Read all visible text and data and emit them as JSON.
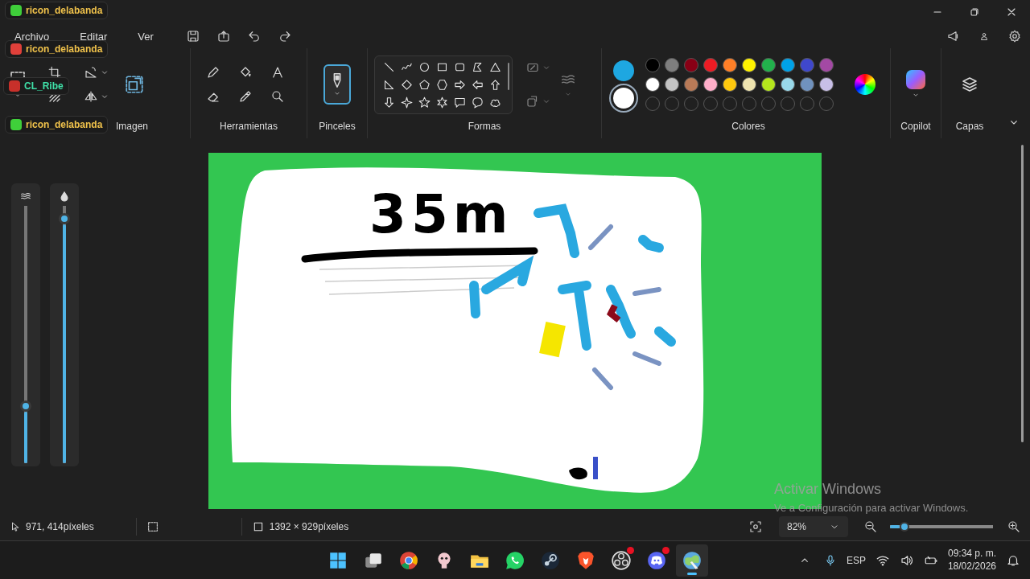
{
  "chat_overlay": [
    {
      "user": "ricon_delabanda",
      "color": "#f0c24b",
      "emote": {
        "color": "#3fcf3a"
      }
    },
    {
      "user": "ricon_delabanda",
      "color": "#f0c24b",
      "emote": {
        "color": "#e0403a"
      }
    },
    {
      "user": "CL_Ribe",
      "color": "#3fe0a8",
      "emote": {
        "color": "#c8302a"
      }
    },
    {
      "user": "ricon_delabanda",
      "color": "#f0c24b",
      "emote": {
        "color": "#3fcf3a"
      }
    }
  ],
  "menu": [
    "Archivo",
    "Editar",
    "Ver"
  ],
  "ribbon": {
    "image_label": "Imagen",
    "tools_label": "Herramientas",
    "brushes": {
      "label": "Pinceles",
      "selected": true
    },
    "shapes_label": "Formas",
    "colors": {
      "label": "Colores",
      "current": [
        {
          "color": "#1ea7e1",
          "selected": false
        },
        {
          "color": "#ffffff",
          "selected": true
        }
      ],
      "palette": [
        {
          "color": "#000000"
        },
        {
          "color": "#7f7f7f"
        },
        {
          "color": "#880015"
        },
        {
          "color": "#ed1c24"
        },
        {
          "color": "#ff7f27"
        },
        {
          "color": "#fff200"
        },
        {
          "color": "#22b14c"
        },
        {
          "color": "#00a2e8"
        },
        {
          "color": "#3f48cc"
        },
        {
          "color": "#a349a4"
        },
        {
          "color": "#ffffff"
        },
        {
          "color": "#c3c3c3"
        },
        {
          "color": "#b97a57"
        },
        {
          "color": "#ffaec9"
        },
        {
          "color": "#ffc90e"
        },
        {
          "color": "#efe4b0"
        },
        {
          "color": "#b5e61d"
        },
        {
          "color": "#99d9ea"
        },
        {
          "color": "#7092be"
        },
        {
          "color": "#c8bfe7"
        }
      ]
    },
    "copilot_label": "Copilot",
    "layers_label": "Capas"
  },
  "side_sliders": [
    {
      "level": 0.21
    },
    {
      "level": 0.97
    }
  ],
  "canvas": {
    "handwriting": "35m"
  },
  "status_bar": {
    "cursor": "971, 414píxeles",
    "size": "1392 × 929píxeles",
    "zoom": "82%",
    "zoom_slider": {
      "level": 0.1
    }
  },
  "activation_notice": {
    "title": "Activar Windows",
    "text": "Ve a Configuración para activar Windows."
  },
  "taskbar": {
    "apps": [
      {
        "kind": "start",
        "selected": false,
        "notification": false
      },
      {
        "kind": "taskview",
        "selected": false,
        "notification": false
      },
      {
        "kind": "browser",
        "selected": false,
        "notification": false
      },
      {
        "kind": "game",
        "selected": false,
        "notification": false
      },
      {
        "kind": "folder",
        "selected": false,
        "notification": false
      },
      {
        "kind": "messenger",
        "selected": false,
        "notification": false
      },
      {
        "kind": "steam",
        "selected": false,
        "notification": false
      },
      {
        "kind": "shield",
        "selected": false,
        "notification": false
      },
      {
        "kind": "recorder",
        "selected": false,
        "notification": true
      },
      {
        "kind": "chat",
        "selected": false,
        "notification": true
      },
      {
        "kind": "paint",
        "selected": true,
        "notification": false
      }
    ],
    "language": "ESP",
    "time": "09:34 p. m.",
    "date": "18/02/2026"
  }
}
